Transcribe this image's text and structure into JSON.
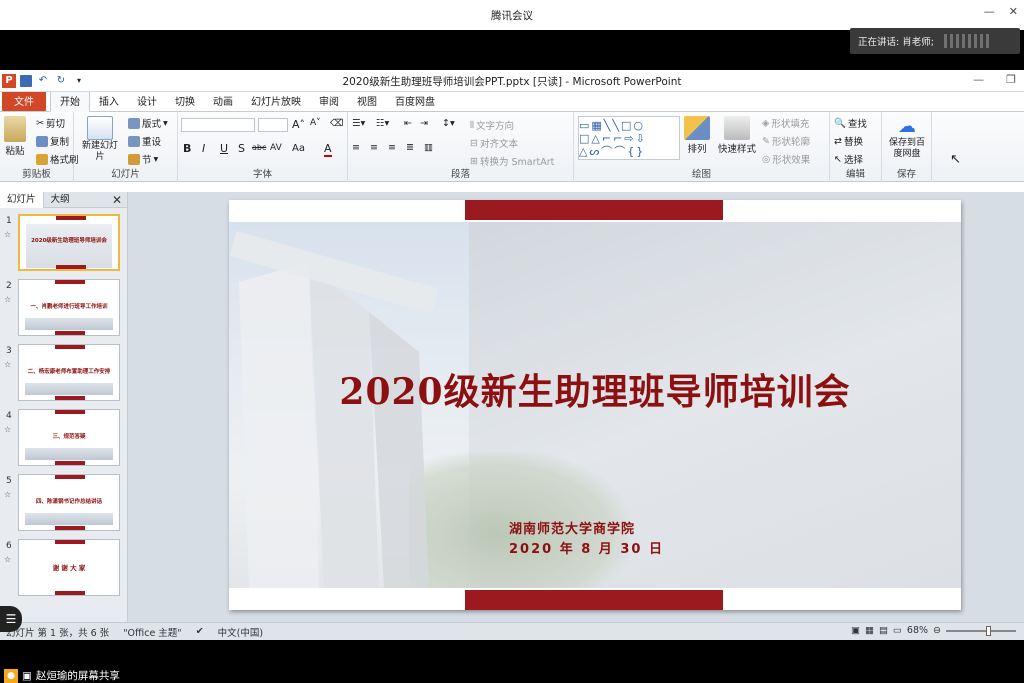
{
  "meeting": {
    "title": "腾讯会议",
    "speaker": "正在讲话: 肖老师;",
    "share_label": "赵烜瑜的屏幕共享"
  },
  "ppt": {
    "window_title": "2020级新生助理班导师培训会PPT.pptx [只读] - Microsoft PowerPoint",
    "logo": "P"
  },
  "tabs": [
    "文件",
    "开始",
    "插入",
    "设计",
    "切换",
    "动画",
    "幻灯片放映",
    "审阅",
    "视图",
    "百度网盘"
  ],
  "ribbon": {
    "clipboard": {
      "label": "剪贴板",
      "paste": "粘贴",
      "cut": "剪切",
      "copy": "复制",
      "format_painter": "格式刷"
    },
    "slides": {
      "label": "幻灯片",
      "new_slide": "新建幻灯片",
      "layout": "版式",
      "reset": "重设",
      "section": "节"
    },
    "font": {
      "label": "字体",
      "bold": "B",
      "italic": "I",
      "underline": "U",
      "shadow": "S",
      "strike": "abc",
      "spacing": "AV",
      "case": "Aa",
      "color": "A"
    },
    "paragraph": {
      "label": "段落",
      "text_direction": "文字方向",
      "align_text": "对齐文本",
      "smartart": "转换为 SmartArt"
    },
    "drawing": {
      "label": "绘图",
      "arrange": "排列",
      "quick_styles": "快速样式",
      "shape_fill": "形状填充",
      "shape_outline": "形状轮廓",
      "shape_effects": "形状效果"
    },
    "editing": {
      "label": "编辑",
      "find": "查找",
      "replace": "替换",
      "select": "选择"
    },
    "save": {
      "label": "保存",
      "save_baidu": "保存到百度网盘"
    }
  },
  "panel": {
    "tab_slides": "幻灯片",
    "tab_outline": "大纲",
    "close": "✕"
  },
  "thumbnails": [
    {
      "num": "1",
      "text": "2020级新生助理班导师培训会"
    },
    {
      "num": "2",
      "text": "一、肖鹏老师进行班导工作培训"
    },
    {
      "num": "3",
      "text": "二、杨宏康老师布置助理工作安排"
    },
    {
      "num": "4",
      "text": "三、规范答疑"
    },
    {
      "num": "5",
      "text": "四、陈潇钢书记作总结讲话"
    },
    {
      "num": "6",
      "text": "谢 谢 大 家"
    }
  ],
  "slide": {
    "title": "2020级新生助理班导师培训会",
    "sub1": "湖南师范大学商学院",
    "sub2": "2020 年 8 月 30 日"
  },
  "status": {
    "slide_info": "幻灯片 第 1 张，共 6 张",
    "theme": "\"Office 主题\"",
    "language": "中文(中国)",
    "zoom": "68%"
  }
}
